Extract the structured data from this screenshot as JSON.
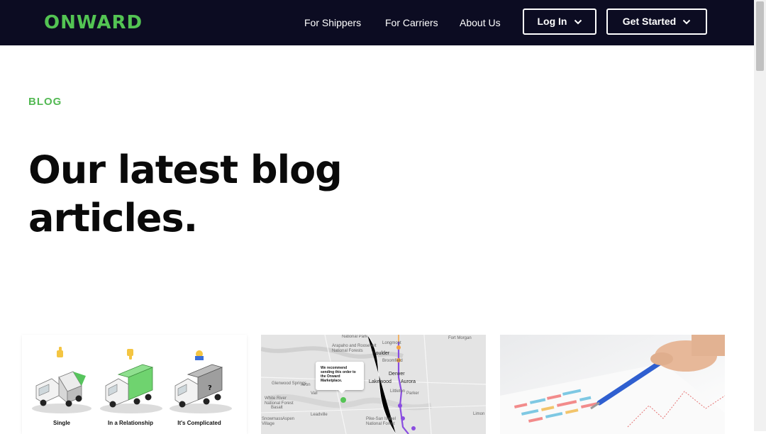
{
  "brand": {
    "logo_text": "ONWARD",
    "accent": "#53c453",
    "nav_bg": "#0c0c22"
  },
  "nav": {
    "links": [
      "For Shippers",
      "For Carriers",
      "About Us"
    ],
    "login_label": "Log In",
    "get_started_label": "Get Started"
  },
  "hero": {
    "eyebrow": "BLOG",
    "headline_line1": "Our latest blog",
    "headline_line2": "articles."
  },
  "cards": [
    {
      "image": "truck-relationship-illustration",
      "captions": [
        "Single",
        "In a Relationship",
        "It's Complicated"
      ]
    },
    {
      "image": "route-map",
      "callout": "We recommend sending this order to the Onward Marketplace.",
      "places": [
        "National Park",
        "Arapaho and Roosevelt National Forests",
        "Longmont",
        "Fort Morgan",
        "Boulder",
        "Broomfield",
        "Denver",
        "Aurora",
        "Lakewood",
        "Littleton",
        "Parker",
        "Glenwood Springs",
        "Avon",
        "Vail",
        "White River National Forest",
        "Basalt",
        "Leadville",
        "Pike-San Isabel National Forest",
        "Limon",
        "Snowmass Village",
        "Aspen"
      ]
    },
    {
      "image": "chart-analysis-photo"
    }
  ]
}
